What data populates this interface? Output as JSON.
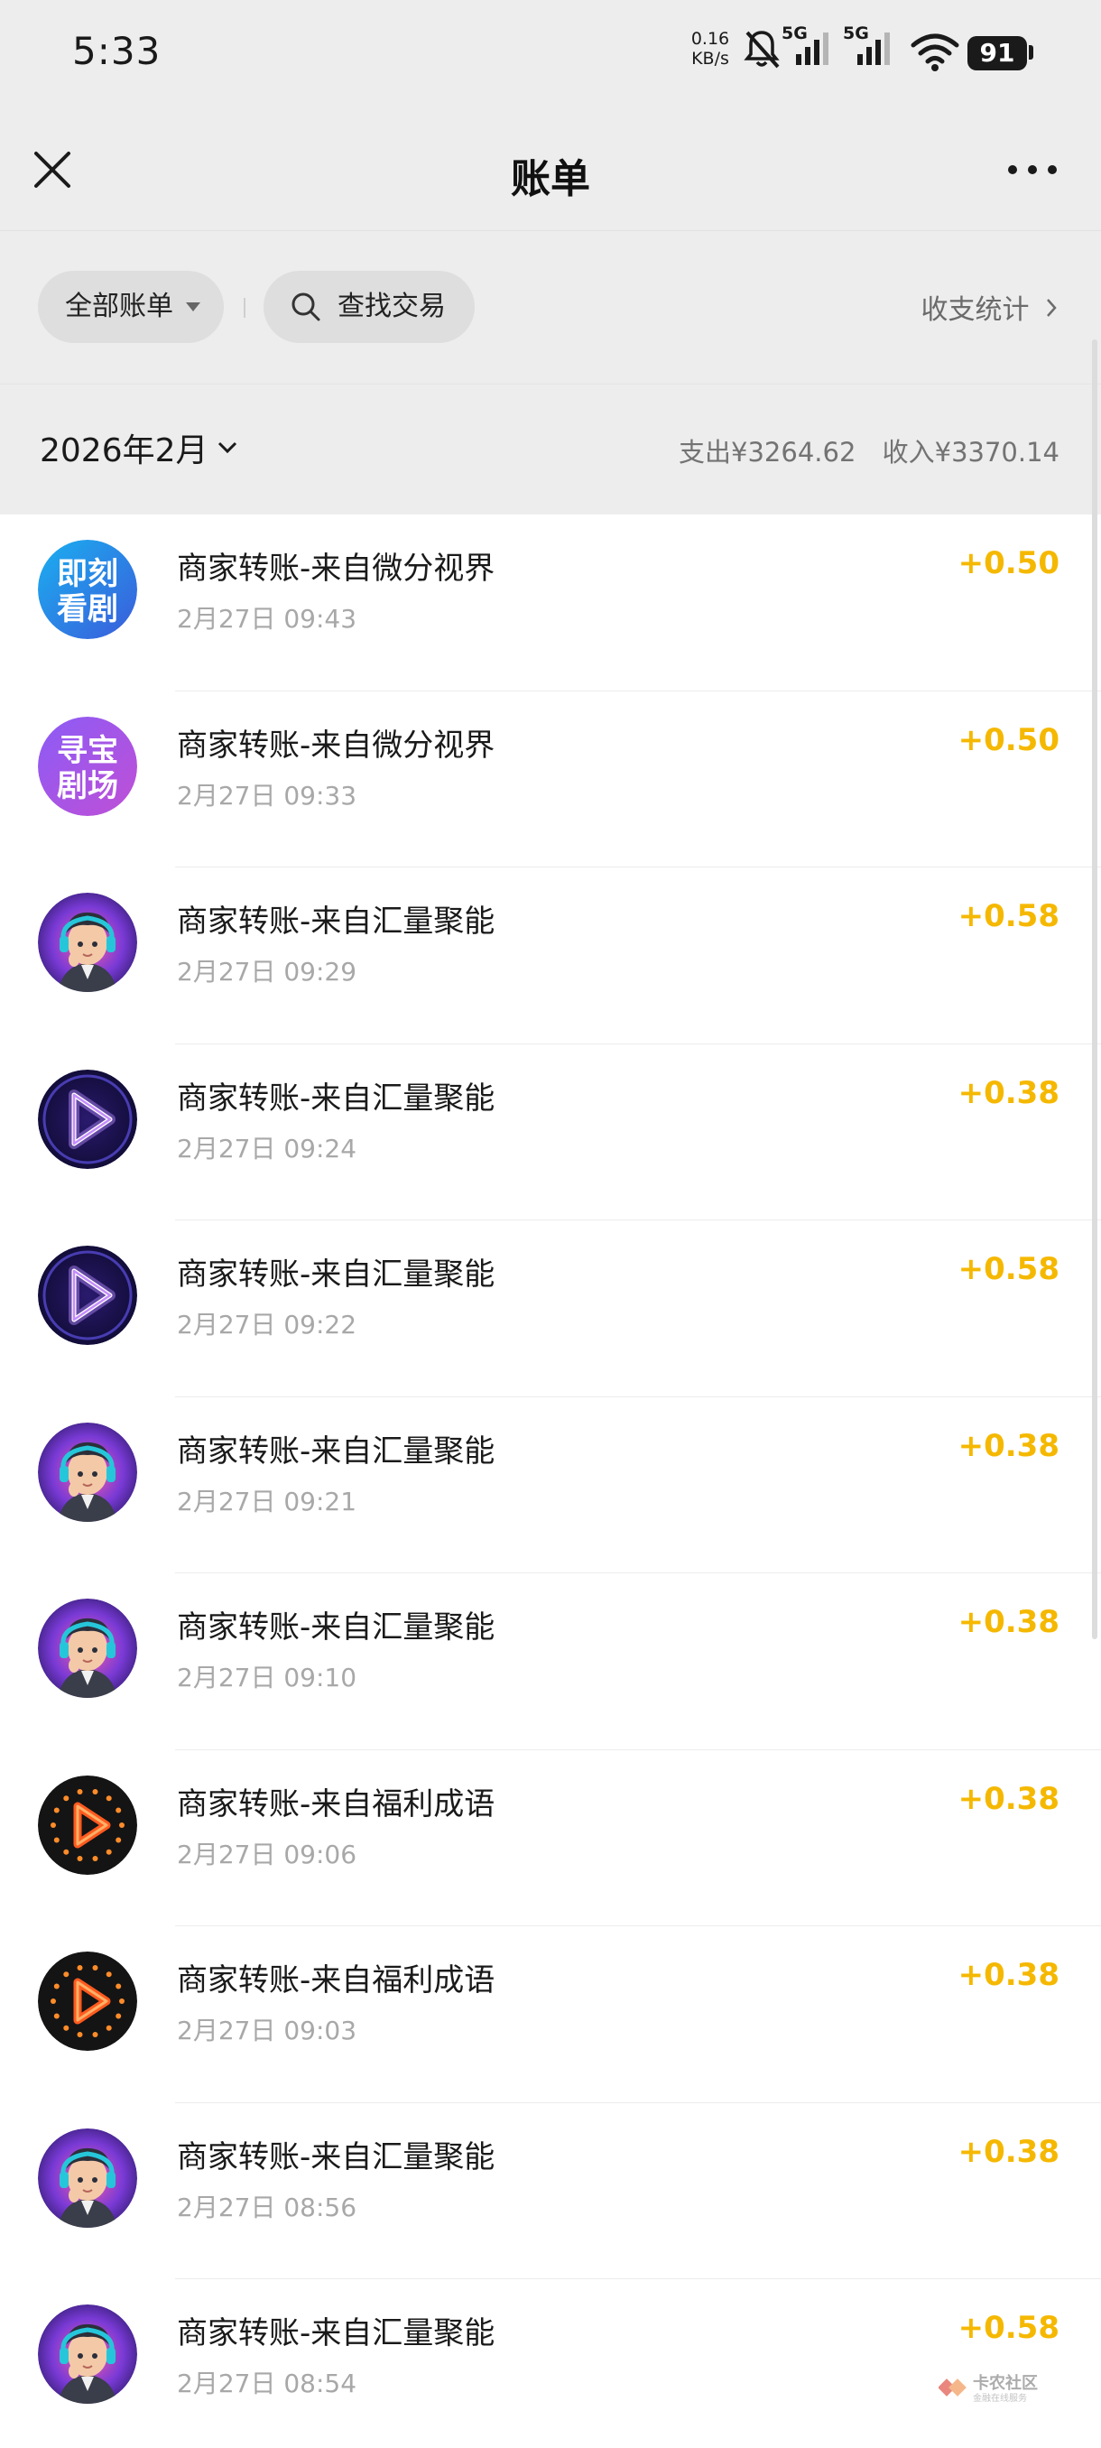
{
  "status_bar": {
    "time": "5:33",
    "net_speed_value": "0.16",
    "net_speed_unit": "KB/s",
    "signal_1_label": "5G",
    "signal_2_label": "5G",
    "battery": "91"
  },
  "header": {
    "title": "账单"
  },
  "filters": {
    "all_bills": "全部账单",
    "search": "查找交易",
    "stats": "收支统计"
  },
  "month_bar": {
    "month": "2026年2月",
    "expense": "支出¥3264.62",
    "income": "收入¥3370.14"
  },
  "colors": {
    "amount": "#f5b800",
    "background": "#ededed"
  },
  "transactions": [
    {
      "title": "商家转账-来自微分视界",
      "time": "2月27日 09:43",
      "amount": "+0.50",
      "avatar": "jike-kanju-avatar",
      "avatar_text": [
        "即刻",
        "看剧"
      ]
    },
    {
      "title": "商家转账-来自微分视界",
      "time": "2月27日 09:33",
      "amount": "+0.50",
      "avatar": "xunbao-juchang-avatar",
      "avatar_text": [
        "寻宝",
        "剧场"
      ]
    },
    {
      "title": "商家转账-来自汇量聚能",
      "time": "2月27日 09:29",
      "amount": "+0.58",
      "avatar": "boy-headphones-avatar"
    },
    {
      "title": "商家转账-来自汇量聚能",
      "time": "2月27日 09:24",
      "amount": "+0.38",
      "avatar": "neon-play-avatar"
    },
    {
      "title": "商家转账-来自汇量聚能",
      "time": "2月27日 09:22",
      "amount": "+0.58",
      "avatar": "neon-play-avatar"
    },
    {
      "title": "商家转账-来自汇量聚能",
      "time": "2月27日 09:21",
      "amount": "+0.38",
      "avatar": "boy-headphones-avatar"
    },
    {
      "title": "商家转账-来自汇量聚能",
      "time": "2月27日 09:10",
      "amount": "+0.38",
      "avatar": "boy-headphones-avatar"
    },
    {
      "title": "商家转账-来自福利成语",
      "time": "2月27日 09:06",
      "amount": "+0.38",
      "avatar": "orange-play-avatar"
    },
    {
      "title": "商家转账-来自福利成语",
      "time": "2月27日 09:03",
      "amount": "+0.38",
      "avatar": "orange-play-avatar"
    },
    {
      "title": "商家转账-来自汇量聚能",
      "time": "2月27日 08:56",
      "amount": "+0.38",
      "avatar": "boy-headphones-avatar"
    },
    {
      "title": "商家转账-来自汇量聚能",
      "time": "2月27日 08:54",
      "amount": "+0.58",
      "avatar": "boy-headphones-avatar"
    }
  ],
  "watermark": {
    "title": "卡农社区",
    "subtitle": "金融在线服务"
  }
}
